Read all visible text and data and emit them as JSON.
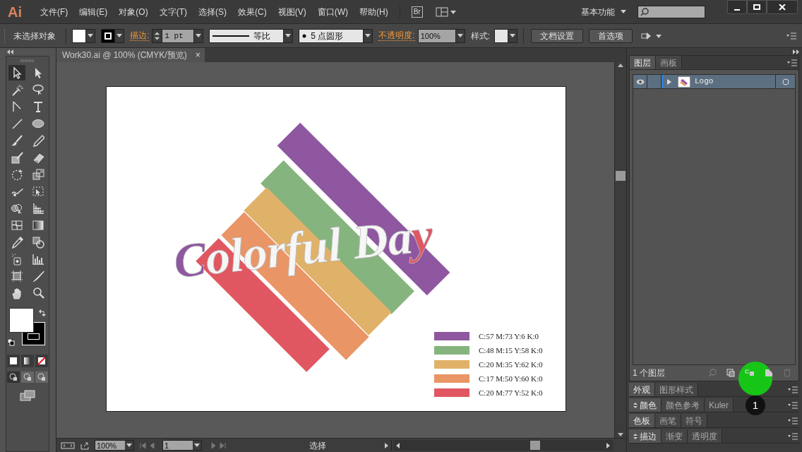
{
  "app_logo": "Ai",
  "menu": [
    "文件(F)",
    "编辑(E)",
    "对象(O)",
    "文字(T)",
    "选择(S)",
    "效果(C)",
    "视图(V)",
    "窗口(W)",
    "帮助(H)"
  ],
  "bridge_button": "Br",
  "workspace": "基本功能",
  "control_bar": {
    "selection": "未选择对象",
    "stroke_label": "描边:",
    "stroke_weight": "1 pt",
    "stroke_profile": "等比",
    "brush": "5 点圆形",
    "opacity_label": "不透明度:",
    "opacity": "100%",
    "style_label": "样式:",
    "buttons": [
      "文档设置",
      "首选项"
    ]
  },
  "document_tab": {
    "title": "Work30.ai @ 100% (CMYK/预览)",
    "close": "×"
  },
  "toolbar": {
    "tools": [
      {
        "selected": true
      },
      {
        "selected": false
      },
      {
        "selected": false
      },
      {
        "selected": false
      },
      {
        "selected": false
      },
      {
        "selected": false
      },
      {
        "selected": false
      },
      {
        "selected": false
      },
      {
        "selected": false
      },
      {
        "selected": false
      },
      {
        "selected": false
      },
      {
        "selected": false
      },
      {
        "selected": false
      },
      {
        "selected": false
      },
      {
        "selected": false
      },
      {
        "selected": false
      },
      {
        "selected": false
      },
      {
        "selected": false
      },
      {
        "selected": false
      },
      {
        "selected": false
      },
      {
        "selected": false
      },
      {
        "selected": false
      },
      {
        "selected": false
      },
      {
        "selected": false
      },
      {
        "selected": false
      },
      {
        "selected": false
      },
      {
        "selected": false
      },
      {
        "selected": false
      }
    ]
  },
  "artwork": {
    "bars": [
      {
        "color": "#8e57a0"
      },
      {
        "color": "#86b47e"
      },
      {
        "color": "#e0b168"
      },
      {
        "color": "#e99566"
      },
      {
        "color": "#e05762"
      }
    ],
    "headline": [
      {
        "text": "C",
        "color": "#8e57a0"
      },
      {
        "text": "olorful Da",
        "color": "#f6f6f6"
      },
      {
        "text": "y",
        "color": "#e05762"
      }
    ],
    "legend": [
      {
        "color": "#8e57a0",
        "label": "C:57 M:73 Y:6 K:0"
      },
      {
        "color": "#86b47e",
        "label": "C:48 M:15 Y:58 K:0"
      },
      {
        "color": "#e0b168",
        "label": "C:20 M:35 Y:62 K:0"
      },
      {
        "color": "#e99566",
        "label": "C:17 M:50 Y:60 K:0"
      },
      {
        "color": "#e05762",
        "label": "C:20 M:77 Y:52 K:0"
      }
    ]
  },
  "layers_panel": {
    "tabs": [
      {
        "label": "图层",
        "selected": true
      },
      {
        "label": "画板",
        "selected": false
      }
    ],
    "layers": [
      {
        "name": "Logo",
        "visible": true,
        "expanded": false
      }
    ],
    "count": "1 个图层"
  },
  "panel_groups": [
    {
      "toggle": false,
      "tabs": [
        {
          "label": "外观",
          "selected": true
        },
        {
          "label": "图形样式",
          "selected": false
        }
      ]
    },
    {
      "toggle": true,
      "tabs": [
        {
          "label": "颜色",
          "selected": true
        },
        {
          "label": "颜色参考",
          "selected": false
        },
        {
          "label": "Kuler",
          "selected": false
        }
      ]
    },
    {
      "toggle": false,
      "tabs": [
        {
          "label": "色板",
          "selected": true
        },
        {
          "label": "画笔",
          "selected": false
        },
        {
          "label": "符号",
          "selected": false
        }
      ]
    },
    {
      "toggle": true,
      "tabs": [
        {
          "label": "描边",
          "selected": true
        },
        {
          "label": "渐变",
          "selected": false
        },
        {
          "label": "透明度",
          "selected": false
        }
      ]
    }
  ],
  "status_bar": {
    "zoom": "100%",
    "artboard": "1",
    "tool": "选择"
  },
  "step_marker": "1"
}
